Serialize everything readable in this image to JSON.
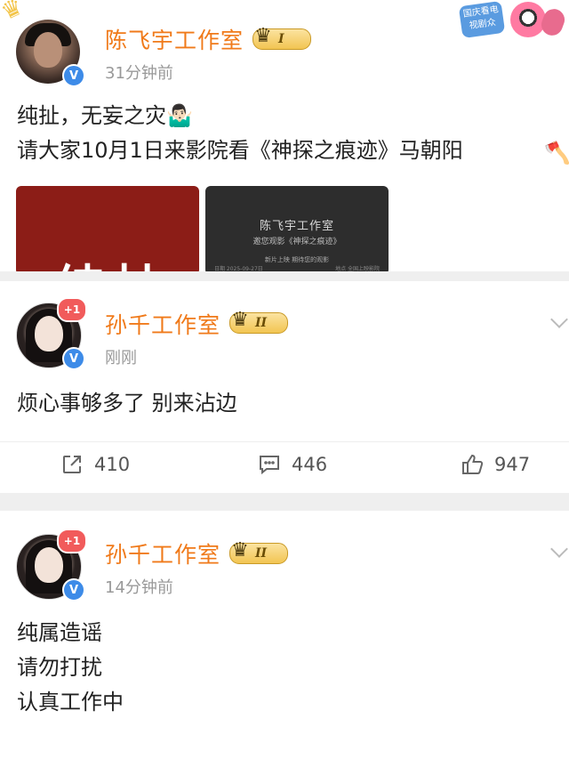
{
  "post1": {
    "author": "陈飞宇工作室",
    "vip_level": "I",
    "time": "31分钟前",
    "lines": [
      "纯扯，无妄之灾🤷🏻‍♂️",
      "请大家10月1日来影院看《神探之痕迹》马朝阳"
    ],
    "image1_text": "纯扯",
    "image2": {
      "title": "陈飞宇工作室",
      "subtitle": "邀您观影《神探之痕迹》",
      "line3": "新片上映 期待您的观影",
      "footer_left": "日期 2025-09-27日",
      "footer_right": "地点 全国上映影院"
    },
    "stamp_text": "国庆看电视剧众"
  },
  "post2": {
    "author": "孙千工作室",
    "vip_level": "II",
    "badge": "+1",
    "time": "刚刚",
    "lines": [
      "烦心事够多了 别来沾边"
    ],
    "actions": {
      "share": "410",
      "comment": "446",
      "like": "947"
    }
  },
  "post3": {
    "author": "孙千工作室",
    "vip_level": "II",
    "badge": "+1",
    "time": "14分钟前",
    "lines": [
      "纯属造谣",
      "请勿打扰",
      "认真工作中"
    ]
  },
  "icons": {
    "verified": "verified-v-icon",
    "vip": "crown-icon",
    "share": "share-icon",
    "comment": "comment-icon",
    "like": "thumbs-up-icon"
  },
  "colors": {
    "author_name": "#f07a1a",
    "verified_badge": "#3d8be8",
    "plus_badge": "#f15b5b",
    "vip_gold": "#f2c552"
  }
}
